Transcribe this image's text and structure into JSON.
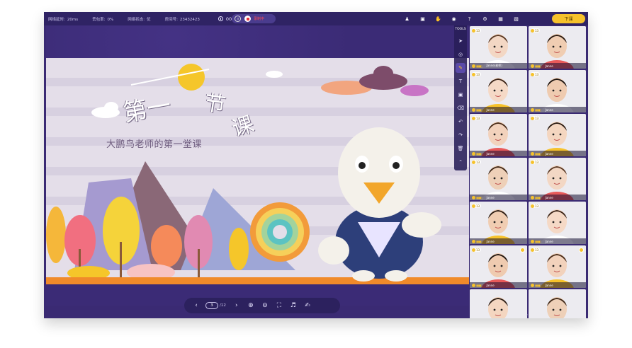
{
  "topbar": {
    "stats": [
      {
        "label": "网络延时:",
        "value": "20ms"
      },
      {
        "label": "丢包率:",
        "value": "0%"
      },
      {
        "label": "网络状态:",
        "value": "优"
      },
      {
        "label": "房间号:",
        "value": "23432423"
      }
    ],
    "timer": "00:03:32",
    "record_label": "录制中",
    "end_button": "下课",
    "icons": [
      "users-icon",
      "camera-icon",
      "hand-icon",
      "chat-icon",
      "help-icon",
      "settings-icon",
      "grid-icon",
      "screen-icon"
    ]
  },
  "slide": {
    "title_1": "第一",
    "title_2": "节",
    "title_3": "课",
    "subtitle": "大鹏鸟老师的第一堂课"
  },
  "tools": {
    "title": "TOOLS",
    "items": [
      "pointer-tool-icon",
      "laser-tool-icon",
      "pen-tool-icon",
      "text-tool-icon",
      "shape-tool-icon",
      "eraser-tool-icon",
      "undo-icon",
      "redo-icon",
      "trash-icon",
      "collapse-tools-icon"
    ]
  },
  "pager": {
    "current": "3",
    "total": "/12"
  },
  "students": [
    {
      "name": "Janne(老师)",
      "stars": "13"
    },
    {
      "name": "Janne",
      "stars": "13"
    },
    {
      "name": "Janne",
      "stars": "13"
    },
    {
      "name": "Janne",
      "stars": "13"
    },
    {
      "name": "Janne",
      "stars": "13"
    },
    {
      "name": "Janne",
      "stars": "13"
    },
    {
      "name": "Janne",
      "stars": "13"
    },
    {
      "name": "Janne",
      "stars": "13"
    },
    {
      "name": "Janne",
      "stars": "13"
    },
    {
      "name": "Janne",
      "stars": "13"
    },
    {
      "name": "Janne",
      "stars": "13"
    },
    {
      "name": "Janne",
      "stars": "13"
    },
    {
      "name": "",
      "stars": ""
    },
    {
      "name": "",
      "stars": ""
    }
  ],
  "colors": {
    "app_bg": "#3a2a73",
    "topbar_bg": "#2f2364",
    "accent": "#f6c22b",
    "record_red": "#ff4b55"
  }
}
